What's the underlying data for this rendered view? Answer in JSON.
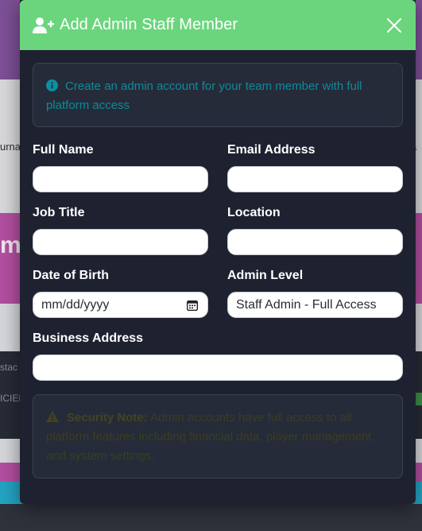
{
  "modal": {
    "title": "Add Admin Staff Member",
    "header_icon": "user-plus-icon",
    "close_icon": "close-icon",
    "header_color": "#6bd57d"
  },
  "info": {
    "icon": "info-circle-icon",
    "text": "Create an admin account for your team member with full platform access"
  },
  "form": {
    "full_name": {
      "label": "Full Name",
      "value": ""
    },
    "email": {
      "label": "Email Address",
      "value": ""
    },
    "job_title": {
      "label": "Job Title",
      "value": ""
    },
    "location": {
      "label": "Location",
      "value": ""
    },
    "dob": {
      "label": "Date of Birth",
      "placeholder": "mm/dd/yyyy",
      "icon": "calendar-icon"
    },
    "admin_level": {
      "label": "Admin Level",
      "selected": "Staff Admin - Full Access"
    },
    "business_address": {
      "label": "Business Address",
      "value": ""
    }
  },
  "warning": {
    "icon": "warning-triangle-icon",
    "strong": "Security Note:",
    "text": "Admin accounts have full access to all platform features including financial data, player management, and system settings."
  },
  "backdrop": {
    "fragment_left_1": "urna",
    "fragment_right_1": "a",
    "fragment_left_2": "me",
    "fragment_left_3": "stac",
    "fragment_left_4": "ICIEN"
  }
}
